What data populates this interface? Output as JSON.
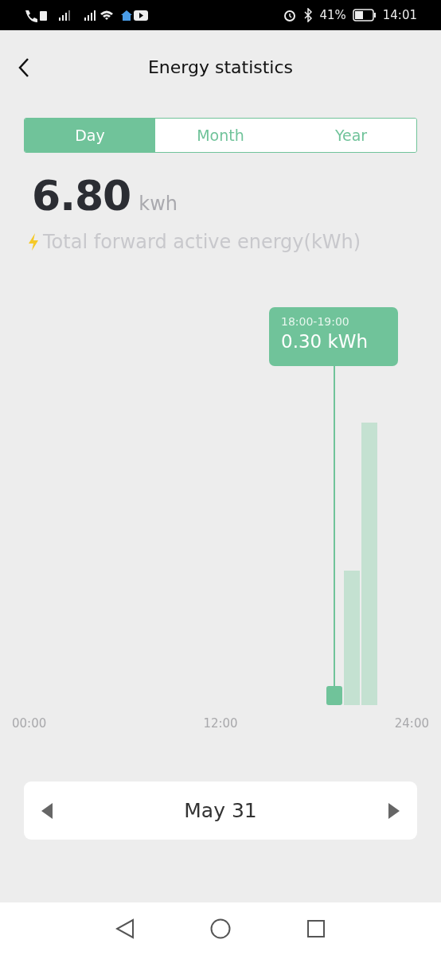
{
  "status_bar": {
    "battery": "41%",
    "time": "14:01"
  },
  "header": {
    "title": "Energy statistics"
  },
  "tabs": [
    {
      "label": "Day",
      "selected": true
    },
    {
      "label": "Month",
      "selected": false
    },
    {
      "label": "Year",
      "selected": false
    }
  ],
  "summary": {
    "value": "6.80",
    "unit": "kwh",
    "caption": "Total forward active energy(kWh)"
  },
  "chart": {
    "tooltip": {
      "range": "18:00-19:00",
      "value": "0.30 kWh"
    },
    "x_axis_labels": [
      "00:00",
      "12:00",
      "24:00"
    ]
  },
  "date_picker": {
    "label": "May 31"
  }
}
